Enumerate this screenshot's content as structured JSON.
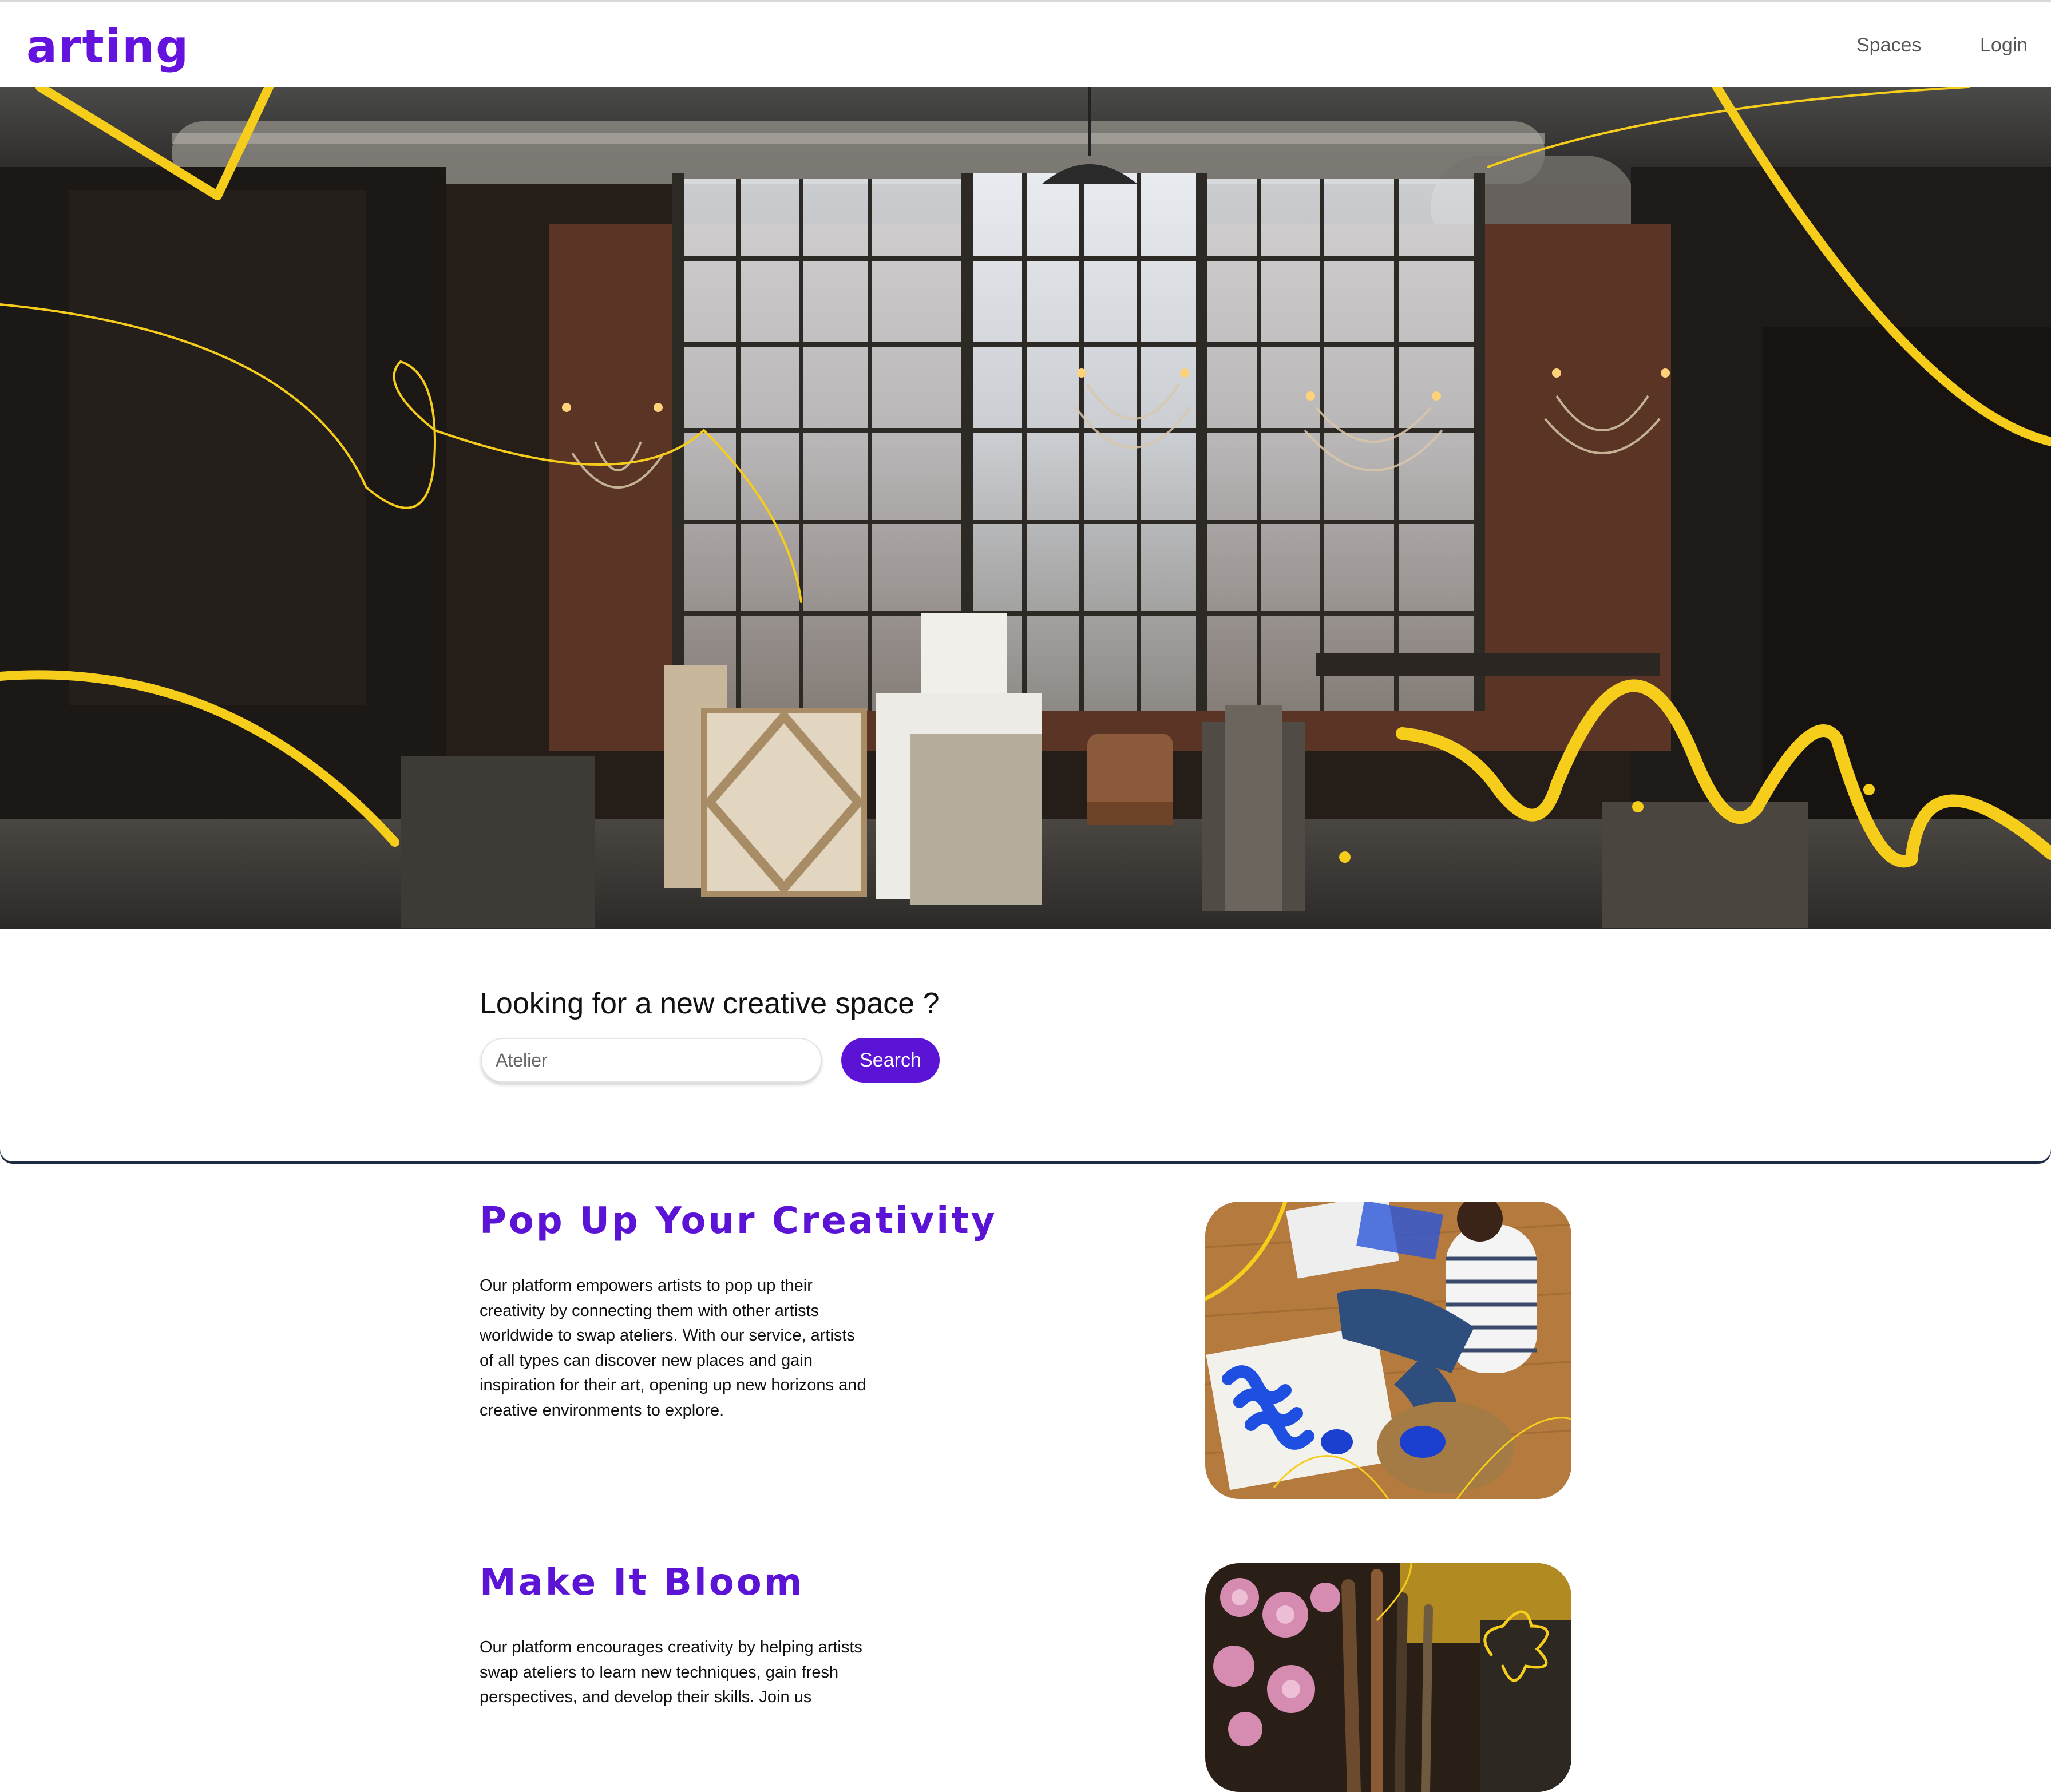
{
  "nav": {
    "logo": "arting",
    "links": [
      "Spaces",
      "Login"
    ]
  },
  "hero": {
    "image": "industrial art studio with large windows, chandeliers and canvases",
    "accent_color": "#f6cd1a"
  },
  "search": {
    "heading": "Looking for a new creative space ?",
    "input_value": "",
    "input_placeholder": "Atelier",
    "button_label": "Search"
  },
  "features": [
    {
      "title": "Pop Up Your Creativity",
      "text": "Our platform empowers artists to pop up their creativity by connecting them with other artists worldwide to swap ateliers. With our service, artists of all types can discover new places and gain inspiration for their art, opening up new horizons and creative environments to explore.",
      "image": "artist painting blue waves on canvas on wooden floor"
    },
    {
      "title": "Make It Bloom",
      "text": "Our platform encourages creativity by helping artists swap ateliers to learn new techniques, gain fresh perspectives, and develop their skills. Join us",
      "image": "pink flowers and paintbrushes"
    }
  ],
  "colors": {
    "brand": "#5b13d6",
    "accent": "#f6cd1a",
    "nav_text": "#555555"
  }
}
